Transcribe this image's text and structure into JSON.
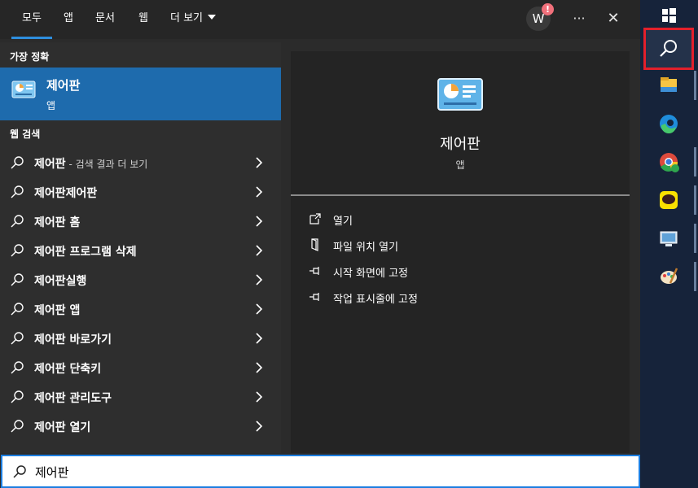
{
  "tabs": [
    {
      "label": "모두",
      "active": true
    },
    {
      "label": "앱",
      "active": false
    },
    {
      "label": "문서",
      "active": false
    },
    {
      "label": "웹",
      "active": false
    },
    {
      "label": "더 보기",
      "active": false
    }
  ],
  "account": {
    "initial": "W",
    "badge": "!"
  },
  "top_actions": {
    "more": "···",
    "close": "✕"
  },
  "best_match": {
    "section_title": "가장 정확",
    "name": "제어판",
    "type": "앱"
  },
  "web_search": {
    "section_title": "웹 검색",
    "items": [
      {
        "bold": "제어판",
        "hint": " - 검색 결과 더 보기"
      },
      {
        "bold": "제어판제어판",
        "hint": ""
      },
      {
        "bold": "제어판 홈",
        "hint": ""
      },
      {
        "bold": "제어판 프로그램 삭제",
        "hint": ""
      },
      {
        "bold": "제어판실행",
        "hint": ""
      },
      {
        "bold": "제어판 앱",
        "hint": ""
      },
      {
        "bold": "제어판 바로가기",
        "hint": ""
      },
      {
        "bold": "제어판 단축키",
        "hint": ""
      },
      {
        "bold": "제어판 관리도구",
        "hint": ""
      },
      {
        "bold": "제어판 열기",
        "hint": ""
      }
    ]
  },
  "preview": {
    "name": "제어판",
    "type": "앱",
    "actions": [
      {
        "label": "열기",
        "icon": "open-icon"
      },
      {
        "label": "파일 위치 열기",
        "icon": "file-location-icon"
      },
      {
        "label": "시작 화면에 고정",
        "icon": "pin-icon"
      },
      {
        "label": "작업 표시줄에 고정",
        "icon": "pin-icon"
      }
    ]
  },
  "search": {
    "value": "제어판"
  },
  "taskbar": {
    "icons": [
      "windows-start-icon",
      "search-icon",
      "file-explorer-icon",
      "edge-icon",
      "chrome-icon",
      "kakaotalk-icon",
      "control-panel-icon",
      "paint-icon"
    ],
    "highlight_color": "#e3202b"
  },
  "colors": {
    "accent": "#1e6bad",
    "panel": "#2b2b2b"
  }
}
